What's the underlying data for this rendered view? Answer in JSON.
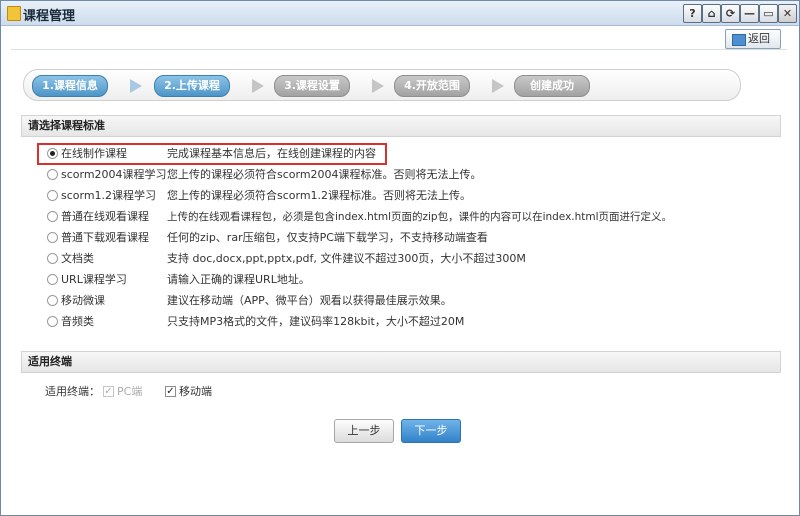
{
  "window": {
    "title": "课程管理",
    "controls": [
      "?",
      "⌂",
      "⟳",
      "—",
      "▭",
      "✕"
    ]
  },
  "toolbar": {
    "return_label": "返回"
  },
  "steps": [
    {
      "label": "1.课程信息",
      "active": true
    },
    {
      "label": "2.上传课程",
      "active": true
    },
    {
      "label": "3.课程设置",
      "active": false
    },
    {
      "label": "4.开放范围",
      "active": false
    },
    {
      "label": "创建成功",
      "active": false
    }
  ],
  "standard_section": {
    "title": "请选择课程标准"
  },
  "options": [
    {
      "label": "在线制作课程",
      "desc": "完成课程基本信息后，在线创建课程的内容",
      "checked": true
    },
    {
      "label": "scorm2004课程学习",
      "desc": "您上传的课程必须符合scorm2004课程标准。否则将无法上传。",
      "checked": false
    },
    {
      "label": "scorm1.2课程学习",
      "desc": "您上传的课程必须符合scorm1.2课程标准。否则将无法上传。",
      "checked": false
    },
    {
      "label": "普通在线观看课程",
      "desc": "上传的在线观看课程包，必须是包含index.html页面的zip包，课件的内容可以在index.html页面进行定义。",
      "checked": false
    },
    {
      "label": "普通下载观看课程",
      "desc": "任何的zip、rar压缩包，仅支持PC端下载学习，不支持移动端查看",
      "checked": false
    },
    {
      "label": "文档类",
      "desc": "支持 doc,docx,ppt,pptx,pdf, 文件建议不超过300页，大小不超过300M",
      "checked": false
    },
    {
      "label": "URL课程学习",
      "desc": "请输入正确的课程URL地址。",
      "checked": false
    },
    {
      "label": "移动微课",
      "desc": "建议在移动端（APP、微平台）观看以获得最佳展示效果。",
      "checked": false
    },
    {
      "label": "音频类",
      "desc": "只支持MP3格式的文件，建议码率128kbit，大小不超过20M",
      "checked": false
    }
  ],
  "terminal_section": {
    "title": "适用终端",
    "row_label": "适用终端：",
    "pc_label": "PC端",
    "mobile_label": "移动端",
    "pc_checked": true,
    "pc_disabled": true,
    "mobile_checked": true
  },
  "buttons": {
    "prev": "上一步",
    "next": "下一步"
  }
}
